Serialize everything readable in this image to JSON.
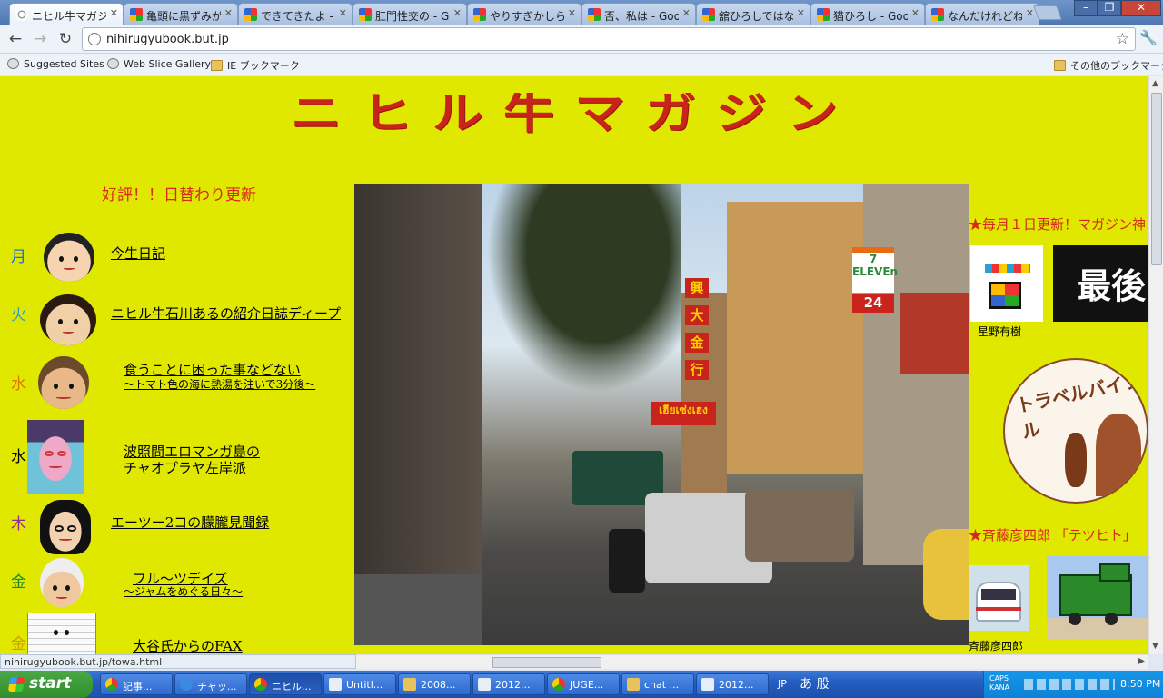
{
  "browser": {
    "tabs": [
      {
        "title": "ニヒル牛マガジン",
        "active": true
      },
      {
        "title": "亀頭に黒ずみが"
      },
      {
        "title": "できてきたよ - Go"
      },
      {
        "title": "肛門性交の - Go"
      },
      {
        "title": "やりすぎかしら - "
      },
      {
        "title": "否、私は - Goog"
      },
      {
        "title": "舘ひろしではなく"
      },
      {
        "title": "猫ひろし - Googl"
      },
      {
        "title": "なんだけれどね。"
      }
    ],
    "address": "nihirugyubook.but.jp",
    "bookmarks": [
      "Suggested Sites",
      "Web Slice Gallery",
      "IE ブックマーク"
    ],
    "other_bookmarks": "その他のブックマーク",
    "status_url": "nihirugyubook.but.jp/towa.html"
  },
  "page": {
    "logo": "ニヒル牛マガジン",
    "tagline": "好評！！日替わり更新",
    "schedule": [
      {
        "day": "月",
        "color": "#1a6fd8",
        "link": "今生日記",
        "sub": ""
      },
      {
        "day": "火",
        "color": "#2a9fd6",
        "link": "ニヒル牛石川あるの紹介日誌ディープ",
        "sub": ""
      },
      {
        "day": "水",
        "color": "#e07800",
        "link": "食うことに困った事などない",
        "sub": "～トマト色の海に熱湯を注いで3分後～"
      },
      {
        "day": "水",
        "color": "#000000",
        "link": "波照間エロマンガ島の",
        "sub": "チャオプラヤ左岸派"
      },
      {
        "day": "木",
        "color": "#9a2a8a",
        "link": "エーツー2コの朦朧見聞録",
        "sub": ""
      },
      {
        "day": "金",
        "color": "#1a8a2a",
        "link": "フル～ツデイズ",
        "sub": "～ジャムをめぐる日々～"
      },
      {
        "day": "金",
        "color": "#c8a000",
        "link": "大谷氏からのFAX",
        "sub": ""
      }
    ],
    "photo_signs": [
      "7 ELEVEn",
      "24",
      "興",
      "大",
      "金",
      "行",
      "เฮียเซ่งเฮง"
    ],
    "right": {
      "heading1": "★毎月１日更新！マガジン神",
      "author1": "星野有樹",
      "banner1": "最後",
      "travel_badge": "トラベルバイブル",
      "heading2": "★斉藤彦四郎 「テツヒト」",
      "author2": "斉藤彦四郎"
    }
  },
  "taskbar": {
    "start": "start",
    "tasks": [
      "記事...",
      "チャッ...",
      "ニヒル...",
      "Untitl...",
      "2008...",
      "2012...",
      "JUGE...",
      "chat ...",
      "2012..."
    ],
    "lang": "JP",
    "ime": "あ 般",
    "caps": "CAPS",
    "kana": "KANA",
    "clock": "8:50 PM"
  }
}
